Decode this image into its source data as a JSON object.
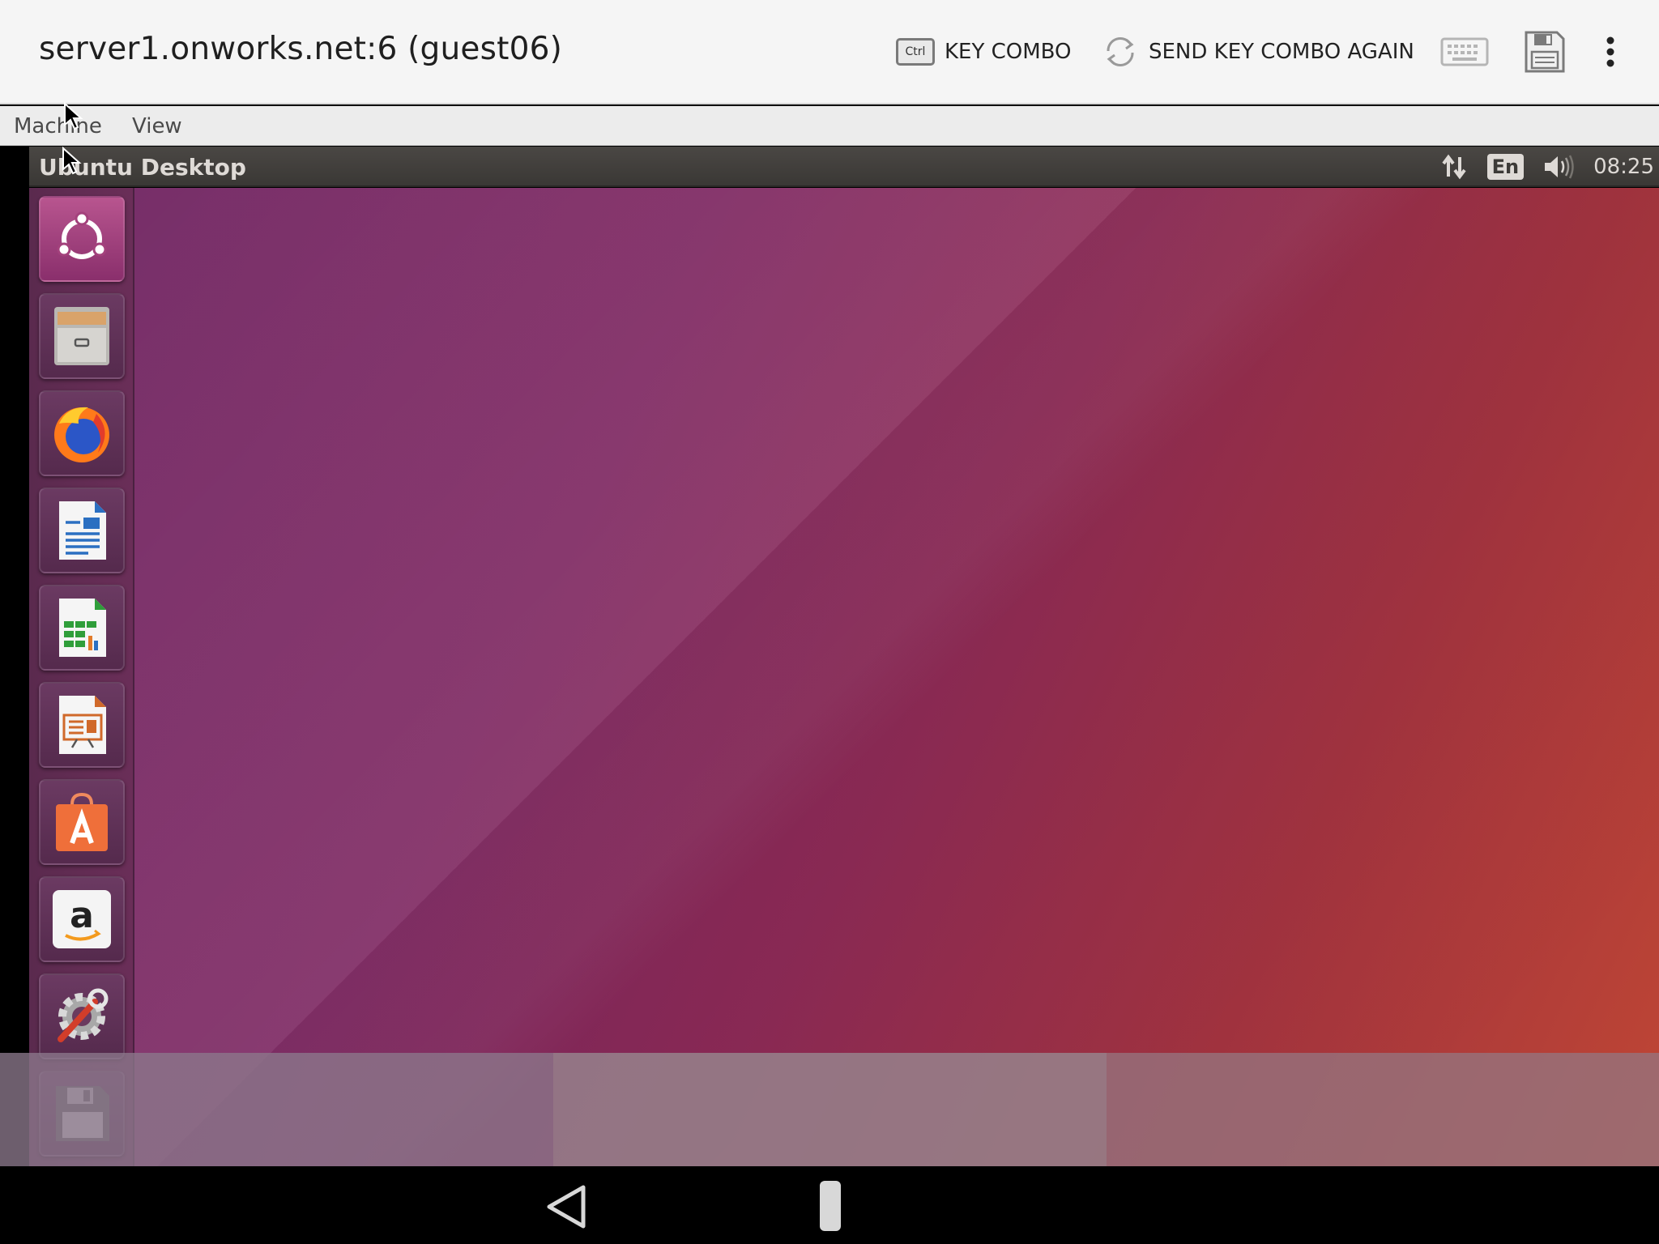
{
  "appbar": {
    "title": "server1.onworks.net:6 (guest06)",
    "key_combo_label": "KEY COMBO",
    "ctrl_key_label": "Ctrl",
    "send_again_label": "SEND KEY COMBO AGAIN",
    "keyboard_icon": "keyboard-icon",
    "save_icon": "floppy-disk-icon",
    "more_icon": "more-vert-icon"
  },
  "menubar": {
    "items": [
      {
        "label": "Machine"
      },
      {
        "label": "View"
      }
    ]
  },
  "remote": {
    "panel_title": "Ubuntu Desktop",
    "indicators": {
      "network_icon": "network-updown-icon",
      "language": "En",
      "volume_icon": "volume-icon",
      "clock": "08:25"
    },
    "launcher": [
      {
        "name": "ubuntu-dash-icon"
      },
      {
        "name": "files-icon"
      },
      {
        "name": "firefox-icon"
      },
      {
        "name": "libreoffice-writer-icon"
      },
      {
        "name": "libreoffice-calc-icon"
      },
      {
        "name": "libreoffice-impress-icon"
      },
      {
        "name": "software-center-icon"
      },
      {
        "name": "amazon-icon"
      },
      {
        "name": "system-settings-icon"
      },
      {
        "name": "floppy-drive-icon"
      }
    ],
    "colors": {
      "wallpaper_left": "#6f2260",
      "wallpaper_right": "#c04634",
      "panel": "#3c3a37"
    }
  },
  "navbar": {
    "back_icon": "nav-back-icon",
    "home_icon": "nav-home-icon"
  }
}
